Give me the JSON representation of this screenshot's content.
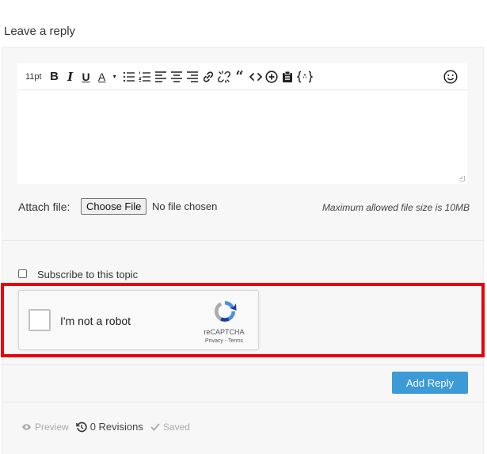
{
  "heading": "Leave a reply",
  "toolbar": {
    "font_size": "11pt",
    "bold": "B",
    "italic": "I",
    "underline": "U",
    "text_color": "A",
    "caret": "▾",
    "quote": "“"
  },
  "attach": {
    "label": "Attach file:",
    "button": "Choose File",
    "status": "No file chosen",
    "max_size_note": "Maximum allowed file size is 10MB"
  },
  "subscribe": {
    "label": "Subscribe to this topic"
  },
  "recaptcha": {
    "label": "I'm not a robot",
    "brand": "reCAPTCHA",
    "links": "Privacy - Terms"
  },
  "actions": {
    "add_reply": "Add Reply"
  },
  "footer": {
    "preview": "Preview",
    "revisions": "0 Revisions",
    "saved": "Saved"
  },
  "colors": {
    "accent": "#3c9bd6",
    "highlight": "#e8000b"
  }
}
